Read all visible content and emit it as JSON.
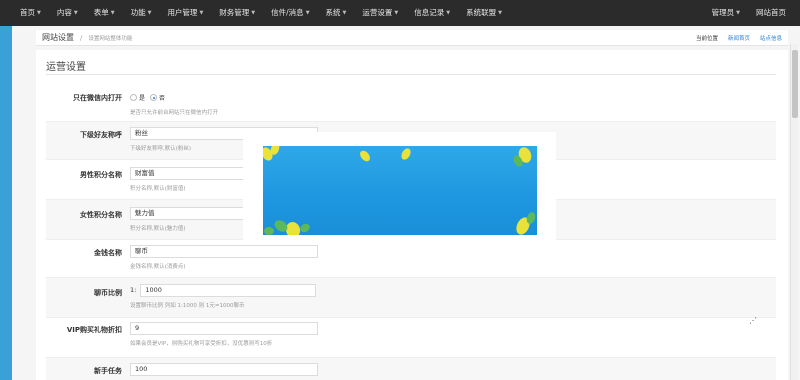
{
  "nav": {
    "items": [
      {
        "label": "首页"
      },
      {
        "label": "内容"
      },
      {
        "label": "表单"
      },
      {
        "label": "功能"
      },
      {
        "label": "用户管理"
      },
      {
        "label": "财务管理"
      },
      {
        "label": "信件/消息"
      },
      {
        "label": "系统"
      },
      {
        "label": "运营设置"
      },
      {
        "label": "信息记录"
      },
      {
        "label": "系统联盟"
      }
    ],
    "right": [
      {
        "label": "管理员"
      },
      {
        "label": "网站首页"
      }
    ]
  },
  "breadcrumb": {
    "title": "网站设置",
    "separator": "/",
    "sub": "设置网站整体功能",
    "current": "当前位置",
    "home": "新闻首页",
    "info": "站点信息"
  },
  "panel": {
    "title": "运营设置"
  },
  "form": {
    "wechat_only": {
      "label": "只在微信内打开",
      "options": [
        "是",
        "否"
      ],
      "selected": "否",
      "hint": "是否只允许前台网站只在微信内打开"
    },
    "friend_name": {
      "label": "下级好友称呼",
      "value": "粉丝",
      "hint": "下级好友称呼,默认(粉丝)"
    },
    "male_points": {
      "label": "男性积分名称",
      "value": "财富值",
      "hint": "积分名称,默认(财富值)"
    },
    "female_points": {
      "label": "女性积分名称",
      "value": "魅力值",
      "hint": "积分名称,默认(魅力值)"
    },
    "currency_name": {
      "label": "金钱名称",
      "value": "聊币",
      "hint": "金钱名称,默认(消费点)"
    },
    "currency_ratio": {
      "label": "聊币比例",
      "prefix": "1:",
      "value": "1000",
      "hint": "设置聊币比例 列如 1:1000 则 1元=1000聊币"
    },
    "vip_discount": {
      "label": "VIP购买礼物折扣",
      "value": "9",
      "hint": "如果会员是VIP，则购买礼物可享受折扣，没优惠则写10折"
    },
    "newbie_task": {
      "label": "新手任务",
      "value": "100"
    }
  },
  "banner": {
    "bg_top": "#2fa8e8",
    "bg_bottom": "#1a8fd8",
    "leaf_yellow": "#e8e23a",
    "leaf_green": "#5cb85c"
  }
}
